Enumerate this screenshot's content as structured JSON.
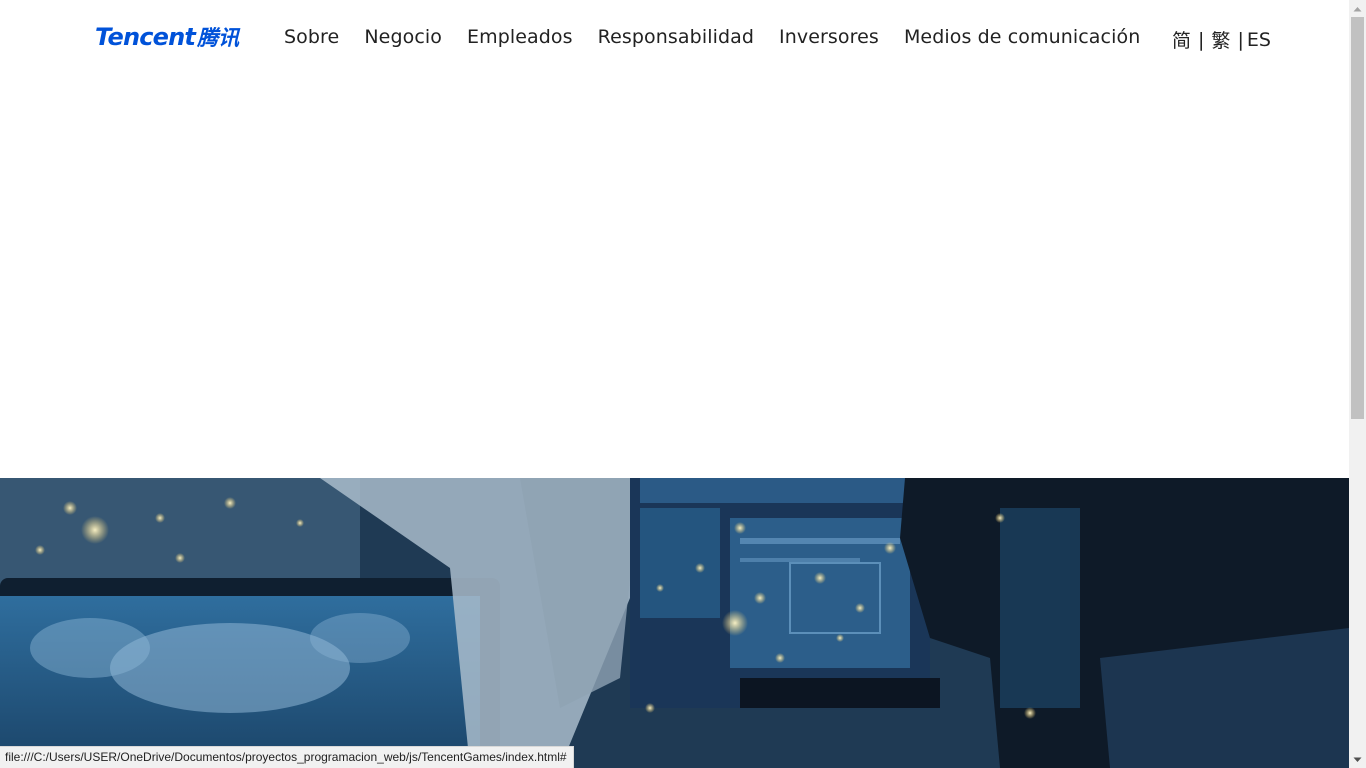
{
  "logo": {
    "text_en": "Tencent",
    "text_cn": "腾讯"
  },
  "nav": {
    "items": [
      {
        "label": "Sobre"
      },
      {
        "label": "Negocio"
      },
      {
        "label": "Empleados"
      },
      {
        "label": "Responsabilidad"
      },
      {
        "label": "Inversores"
      },
      {
        "label": "Medios de comunicación"
      }
    ]
  },
  "lang": {
    "simplified": "简",
    "traditional": "繁",
    "current": "ES",
    "separator": "|"
  },
  "hero": {
    "image": "data-center-control-room-photo"
  },
  "statusbar": {
    "url": "file:///C:/Users/USER/OneDrive/Documentos/proyectos_programacion_web/js/TencentGames/index.html#"
  },
  "colors": {
    "brand": "#0052d9",
    "nav_text": "#222222",
    "background": "#ffffff"
  }
}
